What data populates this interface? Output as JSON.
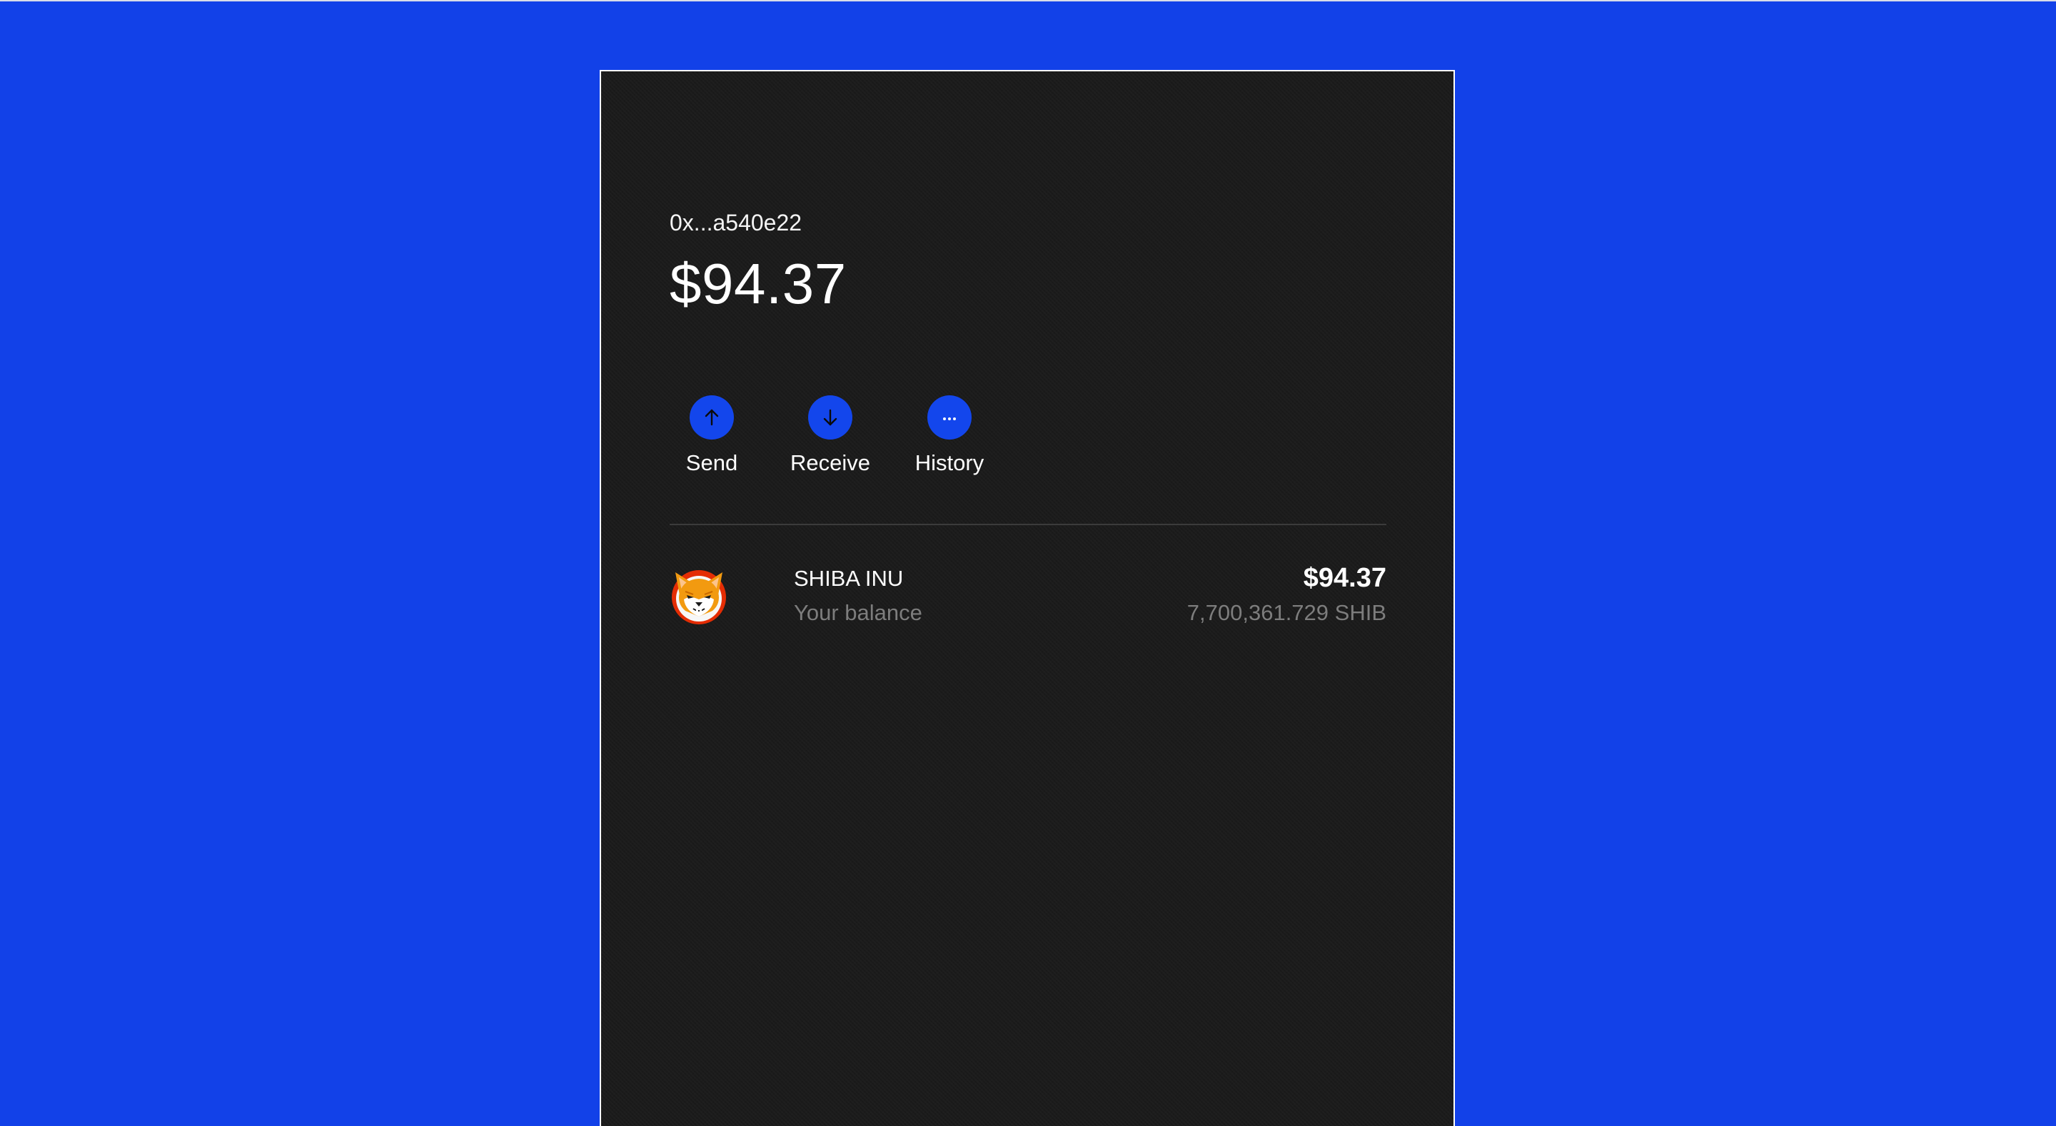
{
  "wallet": {
    "address": "0x...a540e22",
    "total_balance": "$94.37"
  },
  "actions": [
    {
      "label": "Send",
      "icon": "arrow-up-icon"
    },
    {
      "label": "Receive",
      "icon": "arrow-down-icon"
    },
    {
      "label": "History",
      "icon": "more-dots-icon"
    }
  ],
  "tokens": [
    {
      "name": "SHIBA INU",
      "subtitle": "Your balance",
      "usd_value": "$94.37",
      "amount": "7,700,361.729 SHIB",
      "icon": "shiba-inu-logo"
    }
  ],
  "colors": {
    "background": "#1241e8",
    "panel": "#1b1b1b",
    "accent": "#1346ec",
    "muted_text": "#7d7d7d"
  }
}
